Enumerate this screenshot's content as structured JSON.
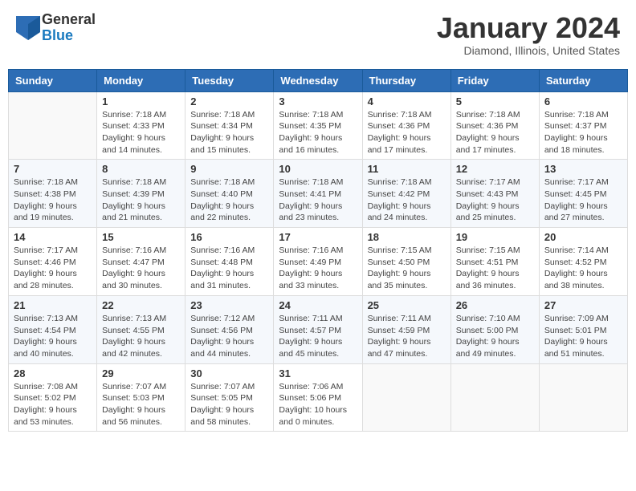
{
  "header": {
    "logo_general": "General",
    "logo_blue": "Blue",
    "month_title": "January 2024",
    "location": "Diamond, Illinois, United States"
  },
  "days_of_week": [
    "Sunday",
    "Monday",
    "Tuesday",
    "Wednesday",
    "Thursday",
    "Friday",
    "Saturday"
  ],
  "weeks": [
    [
      {
        "day": "",
        "sunrise": "",
        "sunset": "",
        "daylight": ""
      },
      {
        "day": "1",
        "sunrise": "Sunrise: 7:18 AM",
        "sunset": "Sunset: 4:33 PM",
        "daylight": "Daylight: 9 hours and 14 minutes."
      },
      {
        "day": "2",
        "sunrise": "Sunrise: 7:18 AM",
        "sunset": "Sunset: 4:34 PM",
        "daylight": "Daylight: 9 hours and 15 minutes."
      },
      {
        "day": "3",
        "sunrise": "Sunrise: 7:18 AM",
        "sunset": "Sunset: 4:35 PM",
        "daylight": "Daylight: 9 hours and 16 minutes."
      },
      {
        "day": "4",
        "sunrise": "Sunrise: 7:18 AM",
        "sunset": "Sunset: 4:36 PM",
        "daylight": "Daylight: 9 hours and 17 minutes."
      },
      {
        "day": "5",
        "sunrise": "Sunrise: 7:18 AM",
        "sunset": "Sunset: 4:36 PM",
        "daylight": "Daylight: 9 hours and 17 minutes."
      },
      {
        "day": "6",
        "sunrise": "Sunrise: 7:18 AM",
        "sunset": "Sunset: 4:37 PM",
        "daylight": "Daylight: 9 hours and 18 minutes."
      }
    ],
    [
      {
        "day": "7",
        "sunrise": "Sunrise: 7:18 AM",
        "sunset": "Sunset: 4:38 PM",
        "daylight": "Daylight: 9 hours and 19 minutes."
      },
      {
        "day": "8",
        "sunrise": "Sunrise: 7:18 AM",
        "sunset": "Sunset: 4:39 PM",
        "daylight": "Daylight: 9 hours and 21 minutes."
      },
      {
        "day": "9",
        "sunrise": "Sunrise: 7:18 AM",
        "sunset": "Sunset: 4:40 PM",
        "daylight": "Daylight: 9 hours and 22 minutes."
      },
      {
        "day": "10",
        "sunrise": "Sunrise: 7:18 AM",
        "sunset": "Sunset: 4:41 PM",
        "daylight": "Daylight: 9 hours and 23 minutes."
      },
      {
        "day": "11",
        "sunrise": "Sunrise: 7:18 AM",
        "sunset": "Sunset: 4:42 PM",
        "daylight": "Daylight: 9 hours and 24 minutes."
      },
      {
        "day": "12",
        "sunrise": "Sunrise: 7:17 AM",
        "sunset": "Sunset: 4:43 PM",
        "daylight": "Daylight: 9 hours and 25 minutes."
      },
      {
        "day": "13",
        "sunrise": "Sunrise: 7:17 AM",
        "sunset": "Sunset: 4:45 PM",
        "daylight": "Daylight: 9 hours and 27 minutes."
      }
    ],
    [
      {
        "day": "14",
        "sunrise": "Sunrise: 7:17 AM",
        "sunset": "Sunset: 4:46 PM",
        "daylight": "Daylight: 9 hours and 28 minutes."
      },
      {
        "day": "15",
        "sunrise": "Sunrise: 7:16 AM",
        "sunset": "Sunset: 4:47 PM",
        "daylight": "Daylight: 9 hours and 30 minutes."
      },
      {
        "day": "16",
        "sunrise": "Sunrise: 7:16 AM",
        "sunset": "Sunset: 4:48 PM",
        "daylight": "Daylight: 9 hours and 31 minutes."
      },
      {
        "day": "17",
        "sunrise": "Sunrise: 7:16 AM",
        "sunset": "Sunset: 4:49 PM",
        "daylight": "Daylight: 9 hours and 33 minutes."
      },
      {
        "day": "18",
        "sunrise": "Sunrise: 7:15 AM",
        "sunset": "Sunset: 4:50 PM",
        "daylight": "Daylight: 9 hours and 35 minutes."
      },
      {
        "day": "19",
        "sunrise": "Sunrise: 7:15 AM",
        "sunset": "Sunset: 4:51 PM",
        "daylight": "Daylight: 9 hours and 36 minutes."
      },
      {
        "day": "20",
        "sunrise": "Sunrise: 7:14 AM",
        "sunset": "Sunset: 4:52 PM",
        "daylight": "Daylight: 9 hours and 38 minutes."
      }
    ],
    [
      {
        "day": "21",
        "sunrise": "Sunrise: 7:13 AM",
        "sunset": "Sunset: 4:54 PM",
        "daylight": "Daylight: 9 hours and 40 minutes."
      },
      {
        "day": "22",
        "sunrise": "Sunrise: 7:13 AM",
        "sunset": "Sunset: 4:55 PM",
        "daylight": "Daylight: 9 hours and 42 minutes."
      },
      {
        "day": "23",
        "sunrise": "Sunrise: 7:12 AM",
        "sunset": "Sunset: 4:56 PM",
        "daylight": "Daylight: 9 hours and 44 minutes."
      },
      {
        "day": "24",
        "sunrise": "Sunrise: 7:11 AM",
        "sunset": "Sunset: 4:57 PM",
        "daylight": "Daylight: 9 hours and 45 minutes."
      },
      {
        "day": "25",
        "sunrise": "Sunrise: 7:11 AM",
        "sunset": "Sunset: 4:59 PM",
        "daylight": "Daylight: 9 hours and 47 minutes."
      },
      {
        "day": "26",
        "sunrise": "Sunrise: 7:10 AM",
        "sunset": "Sunset: 5:00 PM",
        "daylight": "Daylight: 9 hours and 49 minutes."
      },
      {
        "day": "27",
        "sunrise": "Sunrise: 7:09 AM",
        "sunset": "Sunset: 5:01 PM",
        "daylight": "Daylight: 9 hours and 51 minutes."
      }
    ],
    [
      {
        "day": "28",
        "sunrise": "Sunrise: 7:08 AM",
        "sunset": "Sunset: 5:02 PM",
        "daylight": "Daylight: 9 hours and 53 minutes."
      },
      {
        "day": "29",
        "sunrise": "Sunrise: 7:07 AM",
        "sunset": "Sunset: 5:03 PM",
        "daylight": "Daylight: 9 hours and 56 minutes."
      },
      {
        "day": "30",
        "sunrise": "Sunrise: 7:07 AM",
        "sunset": "Sunset: 5:05 PM",
        "daylight": "Daylight: 9 hours and 58 minutes."
      },
      {
        "day": "31",
        "sunrise": "Sunrise: 7:06 AM",
        "sunset": "Sunset: 5:06 PM",
        "daylight": "Daylight: 10 hours and 0 minutes."
      },
      {
        "day": "",
        "sunrise": "",
        "sunset": "",
        "daylight": ""
      },
      {
        "day": "",
        "sunrise": "",
        "sunset": "",
        "daylight": ""
      },
      {
        "day": "",
        "sunrise": "",
        "sunset": "",
        "daylight": ""
      }
    ]
  ]
}
